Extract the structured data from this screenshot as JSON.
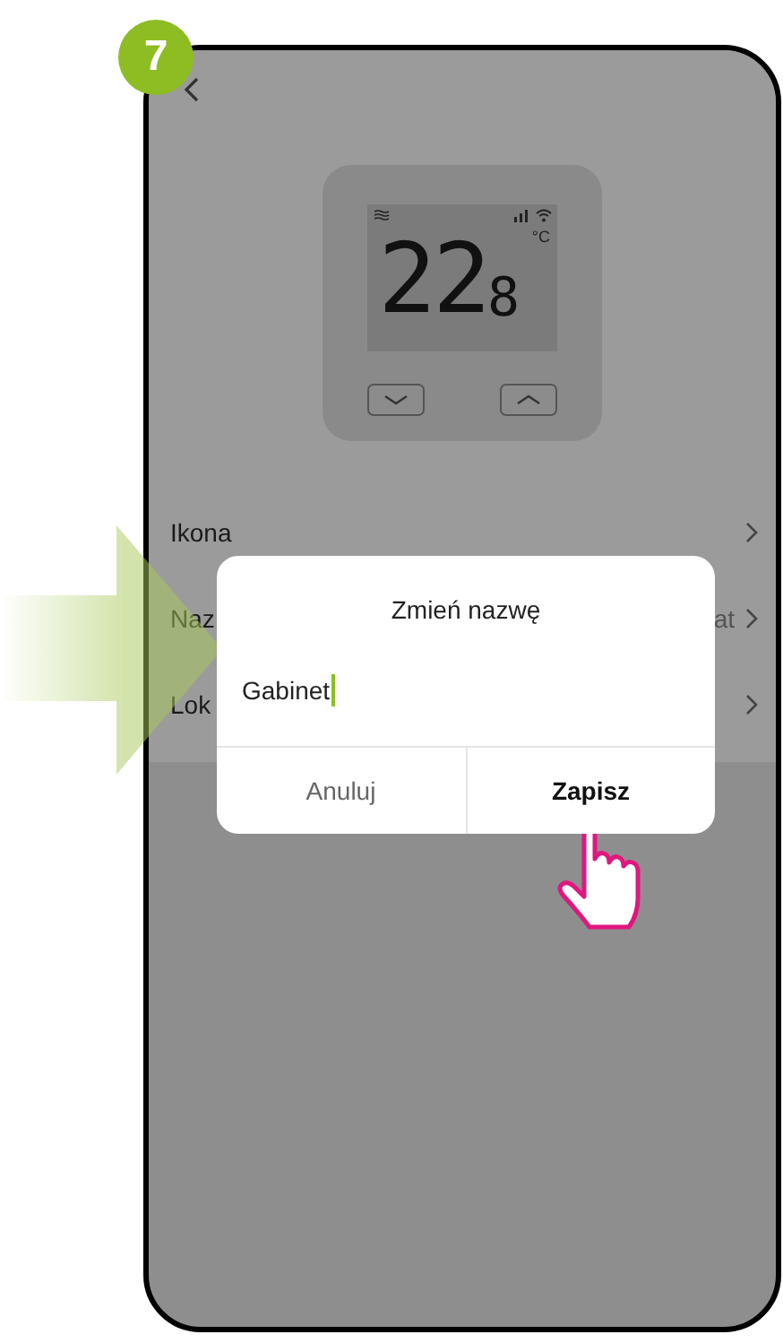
{
  "step_badge": "7",
  "device": {
    "temperature": "22",
    "decimal": "8",
    "unit": "°C"
  },
  "settings": [
    {
      "label": "Ikona"
    },
    {
      "label": "Naz",
      "value": "at"
    },
    {
      "label": "Lok"
    }
  ],
  "dialog": {
    "title": "Zmień nazwę",
    "input": {
      "value": "Gabinet",
      "focused": true
    },
    "buttons": [
      {
        "label": "Anuluj",
        "kind": "cancel"
      },
      {
        "label": "Zapisz",
        "kind": "confirm"
      }
    ]
  }
}
